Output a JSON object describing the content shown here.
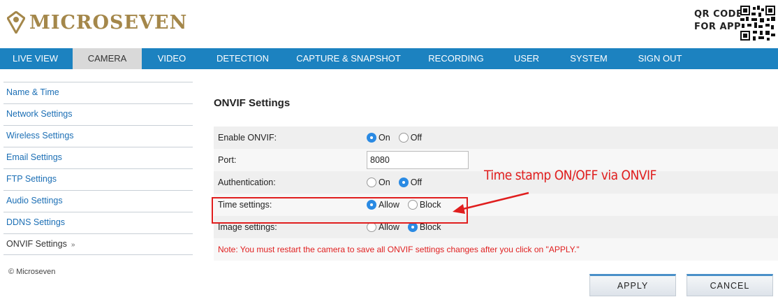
{
  "brand": {
    "name": "MICROSEVEN"
  },
  "qr": {
    "line1": "QR CODE",
    "line2": "FOR APP"
  },
  "nav": [
    {
      "label": "LIVE VIEW",
      "active": false
    },
    {
      "label": "CAMERA",
      "active": true
    },
    {
      "label": "VIDEO",
      "active": false
    },
    {
      "label": "DETECTION",
      "active": false
    },
    {
      "label": "CAPTURE & SNAPSHOT",
      "active": false
    },
    {
      "label": "RECORDING",
      "active": false
    },
    {
      "label": "USER",
      "active": false
    },
    {
      "label": "SYSTEM",
      "active": false
    },
    {
      "label": "SIGN OUT",
      "active": false
    }
  ],
  "sidebar": {
    "items": [
      {
        "label": "Name & Time"
      },
      {
        "label": "Network Settings"
      },
      {
        "label": "Wireless Settings"
      },
      {
        "label": "Email Settings"
      },
      {
        "label": "FTP Settings"
      },
      {
        "label": "Audio Settings"
      },
      {
        "label": "DDNS Settings"
      },
      {
        "label": "ONVIF Settings",
        "active": true,
        "arrow": "»"
      }
    ],
    "copyright": "© Microseven"
  },
  "main": {
    "title": "ONVIF Settings",
    "enable": {
      "label": "Enable ONVIF:",
      "opt1": "On",
      "opt2": "Off",
      "selected": "On"
    },
    "port": {
      "label": "Port:",
      "value": "8080"
    },
    "auth": {
      "label": "Authentication:",
      "opt1": "On",
      "opt2": "Off",
      "selected": "Off"
    },
    "time": {
      "label": "Time settings:",
      "opt1": "Allow",
      "opt2": "Block",
      "selected": "Allow"
    },
    "image": {
      "label": "Image settings:",
      "opt1": "Allow",
      "opt2": "Block",
      "selected": "Block"
    },
    "note": "Note: You must restart the camera to save all ONVIF settings changes after you click on \"APPLY.\""
  },
  "annotation": {
    "text": "Time stamp ON/OFF via ONVIF",
    "color": "#e01e1e"
  },
  "buttons": {
    "apply": "APPLY",
    "cancel": "CANCEL"
  },
  "colors": {
    "nav": "#1c82c0",
    "brand": "#a4874a",
    "link": "#1c6fb5",
    "note": "#e02020"
  }
}
